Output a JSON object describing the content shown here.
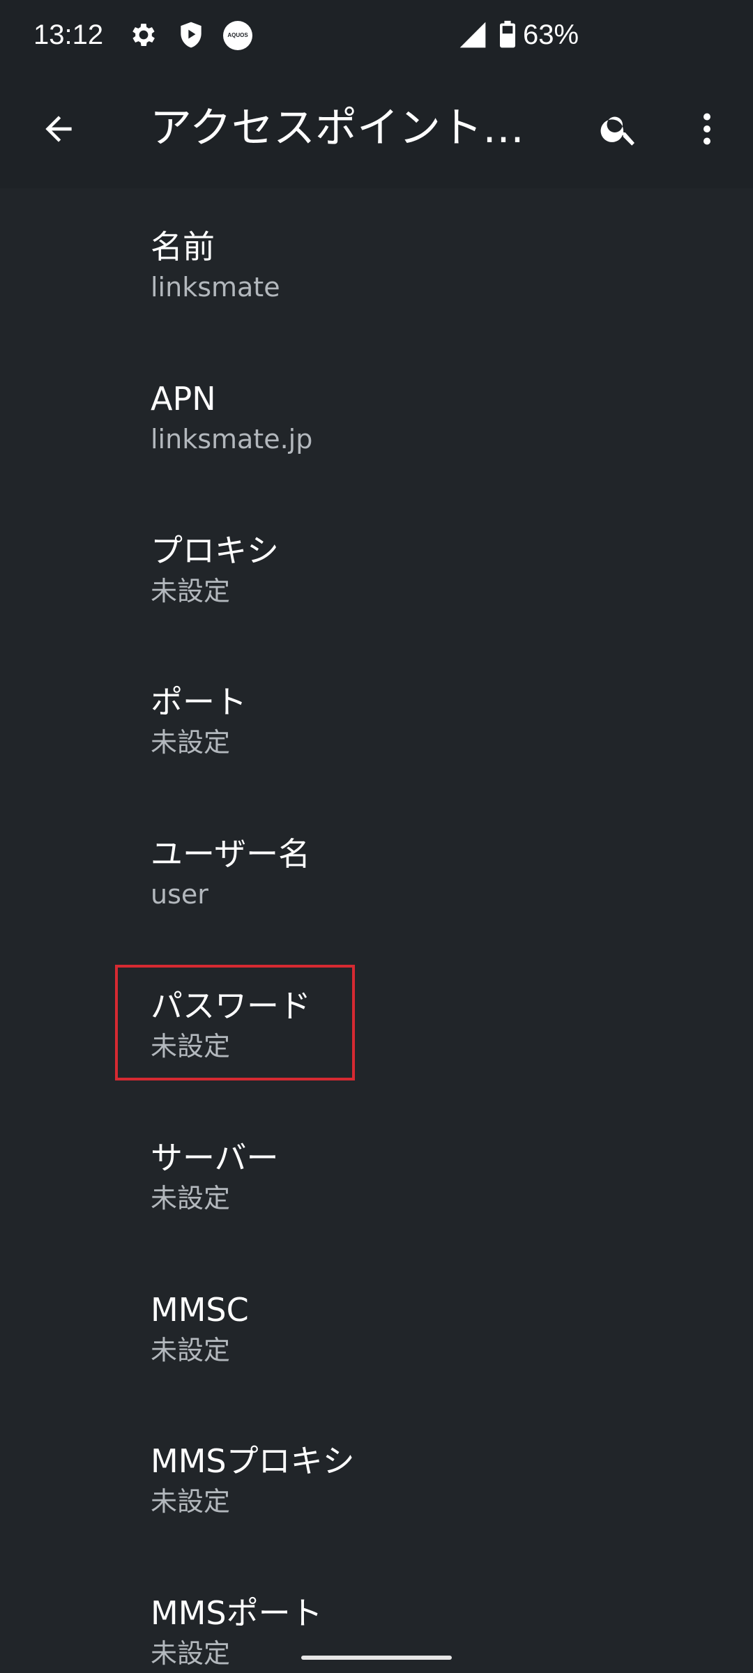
{
  "status_bar": {
    "time": "13:12",
    "icons": [
      "gear-icon",
      "shield-play-icon",
      "aquos-logo",
      "signal-icon",
      "battery-icon"
    ],
    "aquos_label": "AQUOS",
    "battery_percent": "63%"
  },
  "app_bar": {
    "title": "アクセスポイント…",
    "back_icon": "arrow-back-icon",
    "search_icon": "search-icon",
    "more_icon": "more-vert-icon"
  },
  "items": [
    {
      "title": "名前",
      "value": "linksmate"
    },
    {
      "title": "APN",
      "value": "linksmate.jp"
    },
    {
      "title": "プロキシ",
      "value": "未設定"
    },
    {
      "title": "ポート",
      "value": "未設定"
    },
    {
      "title": "ユーザー名",
      "value": "user"
    },
    {
      "title": "パスワード",
      "value": "未設定"
    },
    {
      "title": "サーバー",
      "value": "未設定"
    },
    {
      "title": "MMSC",
      "value": "未設定"
    },
    {
      "title": "MMSプロキシ",
      "value": "未設定"
    },
    {
      "title": "MMSポート",
      "value": "未設定"
    }
  ],
  "colors": {
    "background": "#212529",
    "bar_background": "#1e2226",
    "primary_text": "#ffffff",
    "secondary_text": "#b3b8bd",
    "highlight": "#d62a32"
  }
}
